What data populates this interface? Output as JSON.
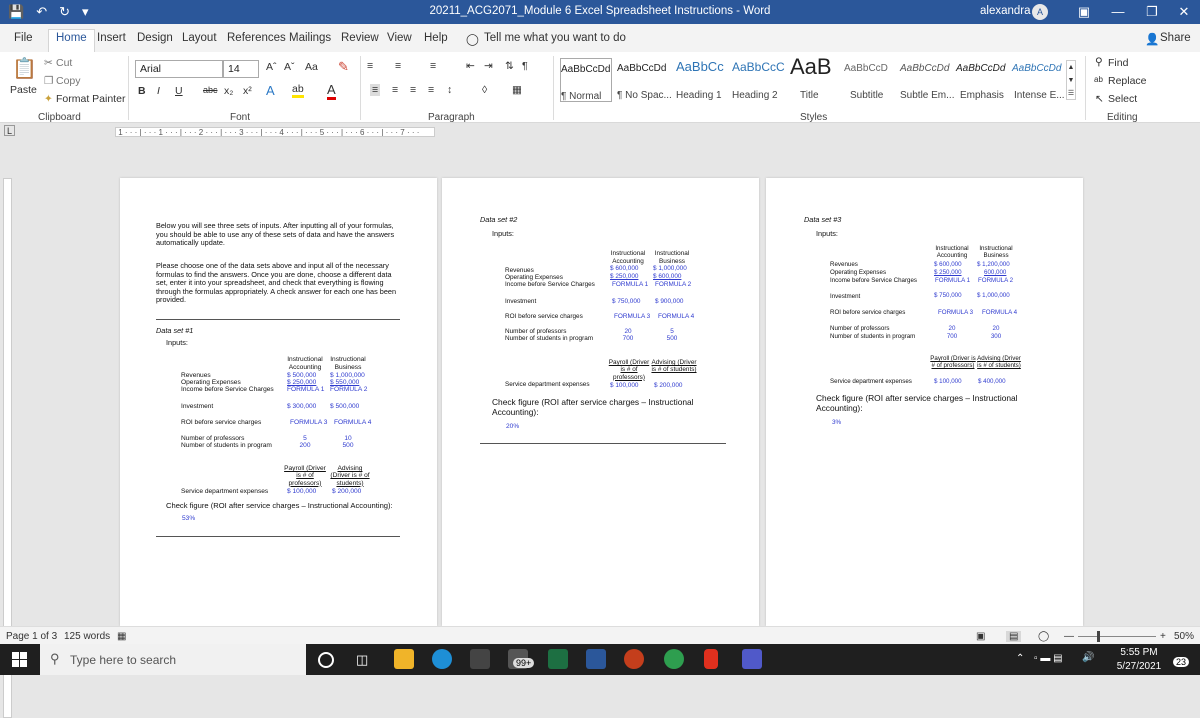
{
  "titlebar": {
    "title": "20211_ACG2071_Module 6 Excel Spreadsheet Instructions - Word",
    "user": "alexandra",
    "avatar": "A"
  },
  "tabs": [
    "File",
    "Home",
    "Insert",
    "Design",
    "Layout",
    "References",
    "Mailings",
    "Review",
    "View",
    "Help"
  ],
  "tell_me": "Tell me what you want to do",
  "share": "Share",
  "clipboard": {
    "cut": "Cut",
    "copy": "Copy",
    "paste": "Paste",
    "format_painter": "Format Painter",
    "label": "Clipboard"
  },
  "font": {
    "name": "Arial",
    "size": "14",
    "label": "Font",
    "case": "Aa"
  },
  "paragraph_label": "Paragraph",
  "styles": {
    "label": "Styles",
    "items": [
      {
        "sample": "AaBbCcDd",
        "name": "¶ Normal"
      },
      {
        "sample": "AaBbCcDd",
        "name": "¶ No Spac..."
      },
      {
        "sample": "AaBbCc",
        "name": "Heading 1"
      },
      {
        "sample": "AaBbCcC",
        "name": "Heading 2"
      },
      {
        "sample": "AaB",
        "name": "Title"
      },
      {
        "sample": "AaBbCcD",
        "name": "Subtitle"
      },
      {
        "sample": "AaBbCcDd",
        "name": "Subtle Em..."
      },
      {
        "sample": "AaBbCcDd",
        "name": "Emphasis"
      },
      {
        "sample": "AaBbCcDd",
        "name": "Intense E..."
      }
    ]
  },
  "editing": {
    "find": "Find",
    "replace": "Replace",
    "select": "Select",
    "label": "Editing"
  },
  "page1": {
    "intro": "Below you will see three sets of inputs.  After inputting all of your formulas, you should be able to use any of these sets of data and have the answers automatically update.",
    "instructions": "Please choose one of the data sets above and input all of the necessary formulas to find the answers. Once you are done, choose a different data set, enter it into your spreadsheet, and check that everything is flowing through the formulas appropriately. A check answer for each one has been provided.",
    "title": "Data set #1",
    "inputs": "Inputs:",
    "col1": "Instructional Accounting",
    "col2": "Instructional Business",
    "rev_label": "Revenues",
    "rev1": "$ 500,000",
    "rev2": "$ 1,000,000",
    "opex_label": "Operating Expenses",
    "opex1": "$ 250,000",
    "opex2": "$ 550,000",
    "ibsc_label": "Income before Service Charges",
    "f1": "FORMULA 1",
    "f2": "FORMULA 2",
    "inv_label": "Investment",
    "inv1": "$ 300,000",
    "inv2": "$ 500,000",
    "roi_label": "ROI before service charges",
    "f3": "FORMULA 3",
    "f4": "FORMULA 4",
    "prof_label": "Number of professors",
    "prof1": "5",
    "prof2": "10",
    "stud_label": "Number of students in program",
    "stud1": "200",
    "stud2": "500",
    "payroll": "Payroll (Driver is # of professors)",
    "advising": "Advising (Driver is # of students)",
    "sde_label": "Service department expenses",
    "pay_val": "$ 100,000",
    "adv_val": "$ 200,000",
    "check": "Check figure (ROI after service charges – Instructional Accounting):",
    "check_val": "53%"
  },
  "page2": {
    "title": "Data set #2",
    "inputs": "Inputs:",
    "col1": "Instructional Accounting",
    "col2": "Instructional Business",
    "rev_label": "Revenues",
    "rev1": "$ 600,000",
    "rev2": "$ 1,000,000",
    "opex_label": "Operating Expenses",
    "opex1": "$ 250,000",
    "opex2": "$ 600,000",
    "ibsc_label": "Income before Service Charges",
    "f1": "FORMULA 1",
    "f2": "FORMULA 2",
    "inv_label": "Investment",
    "inv1": "$ 750,000",
    "inv2": "$ 900,000",
    "roi_label": "ROI before service charges",
    "f3": "FORMULA 3",
    "f4": "FORMULA 4",
    "prof_label": "Number of professors",
    "prof1": "20",
    "prof2": "5",
    "stud_label": "Number of students in program",
    "stud1": "700",
    "stud2": "500",
    "payroll": "Payroll (Driver is # of professors)",
    "advising": "Advising (Driver is # of students)",
    "sde_label": "Service department expenses",
    "pay_val": "$ 100,000",
    "adv_val": "$ 200,000",
    "check": "Check figure (ROI after service charges – Instructional Accounting):",
    "check_val": "20%"
  },
  "page3": {
    "title": "Data set #3",
    "inputs": "Inputs:",
    "col1": "Instructional Accounting",
    "col2": "Instructional Business",
    "rev_label": "Revenues",
    "rev1": "$ 600,000",
    "rev2": "$ 1,200,000",
    "opex_label": "Operating Expenses",
    "opex1": "$ 250,000",
    "opex2": "600,000",
    "ibsc_label": "Income before Service Charges",
    "f1": "FORMULA 1",
    "f2": "FORMULA 2",
    "inv_label": "Investment",
    "inv1": "$ 750,000",
    "inv2": "$ 1,000,000",
    "roi_label": "ROI before service charges",
    "f3": "FORMULA 3",
    "f4": "FORMULA 4",
    "prof_label": "Number of professors",
    "prof1": "20",
    "prof2": "20",
    "stud_label": "Number of students in program",
    "stud1": "700",
    "stud2": "300",
    "payroll": "Payroll (Driver is # of professors)",
    "advising": "Advising (Driver is # of students)",
    "sde_label": "Service department expenses",
    "pay_val": "$ 100,000",
    "adv_val": "$ 400,000",
    "check": "Check figure (ROI after service charges – Instructional Accounting):",
    "check_val": "3%"
  },
  "status": {
    "page": "Page 1 of 3",
    "words": "125 words",
    "zoom": "50%"
  },
  "taskbar": {
    "search": "Type here to search",
    "badge": "99+",
    "time": "5:55 PM",
    "date": "5/27/2021",
    "notif": "23"
  }
}
